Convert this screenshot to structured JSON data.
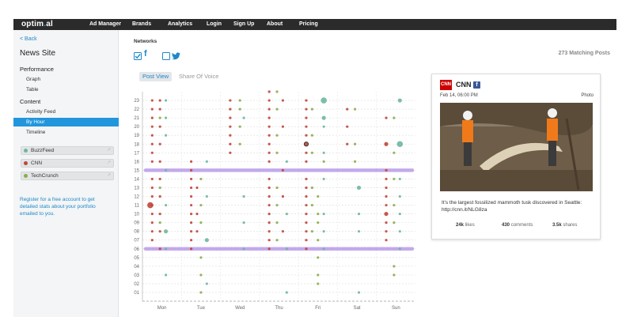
{
  "brand": {
    "logo_main": "optim",
    "logo_dot": ".",
    "logo_tail": "al"
  },
  "nav": {
    "items": [
      {
        "label": "Ad Manager",
        "caret": false
      },
      {
        "label": "Brands",
        "caret": true
      },
      {
        "label": "Analytics",
        "caret": true
      },
      {
        "label": "Login",
        "caret": false
      },
      {
        "label": "Sign Up",
        "caret": false
      },
      {
        "label": "About",
        "caret": true
      },
      {
        "label": "Pricing",
        "caret": false
      }
    ]
  },
  "sidebar": {
    "back_label": "< Back",
    "site_title": "News Site",
    "performance_label": "Performance",
    "performance_items": [
      "Graph",
      "Table"
    ],
    "content_label": "Content",
    "content_items": [
      "Activity Feed",
      "By Hour",
      "Timeline"
    ],
    "active_item": "By Hour",
    "brands": [
      {
        "label": "BuzzFeed",
        "color": "#6fb6a0"
      },
      {
        "label": "CNN",
        "color": "#c0463a"
      },
      {
        "label": "TechCrunch",
        "color": "#8aad4a"
      }
    ],
    "register_text": "Register for a free account to get detailed stats about your portfolio emailed to you."
  },
  "main": {
    "networks_label": "Networks",
    "matching_posts": "273 Matching Posts",
    "networks": [
      {
        "name": "facebook",
        "checked": true
      },
      {
        "name": "twitter",
        "checked": false
      }
    ],
    "tabs": [
      {
        "label": "Post View",
        "active": true
      },
      {
        "label": "Share Of Voice",
        "active": false
      }
    ]
  },
  "chart_data": {
    "type": "scatter",
    "x_categories": [
      "Mon",
      "Tue",
      "Wed",
      "Thu",
      "Fri",
      "Sat",
      "Sun"
    ],
    "y_ticks": [
      "01",
      "02",
      "03",
      "04",
      "05",
      "06",
      "07",
      "08",
      "09",
      "10",
      "11",
      "12",
      "13",
      "14",
      "15",
      "16",
      "17",
      "18",
      "19",
      "20",
      "21",
      "22",
      "23"
    ],
    "ylim": [
      0,
      24
    ],
    "highlight_band_hours": [
      6,
      15
    ],
    "series": [
      {
        "name": "BuzzFeed",
        "color": "#6fb6a0"
      },
      {
        "name": "CNN",
        "color": "#c0463a"
      },
      {
        "name": "TechCrunch",
        "color": "#8aad4a"
      }
    ],
    "points": [
      [
        0,
        -0.25,
        23,
        "c",
        1
      ],
      [
        0,
        -0.25,
        22,
        "c",
        1
      ],
      [
        0,
        -0.25,
        21,
        "c",
        1
      ],
      [
        0,
        -0.25,
        20,
        "c",
        1
      ],
      [
        0,
        -0.25,
        19,
        "c",
        1
      ],
      [
        0,
        -0.25,
        18,
        "c",
        1
      ],
      [
        0,
        -0.25,
        17,
        "c",
        1
      ],
      [
        0,
        -0.25,
        16,
        "c",
        1
      ],
      [
        0,
        -0.25,
        14,
        "c",
        1
      ],
      [
        0,
        -0.25,
        13,
        "c",
        1
      ],
      [
        0,
        -0.25,
        12,
        "c",
        1
      ],
      [
        0,
        -0.25,
        11,
        "c",
        1
      ],
      [
        0,
        -0.25,
        10,
        "c",
        1
      ],
      [
        0,
        -0.25,
        9,
        "c",
        1
      ],
      [
        0,
        -0.25,
        8,
        "c",
        1
      ],
      [
        0,
        -0.25,
        7,
        "c",
        1
      ],
      [
        0,
        -0.3,
        11,
        "c",
        3
      ],
      [
        0,
        -0.05,
        23,
        "c",
        1
      ],
      [
        0,
        -0.05,
        22,
        "c",
        1
      ],
      [
        0,
        -0.05,
        20,
        "c",
        1
      ],
      [
        0,
        -0.05,
        18,
        "c",
        1
      ],
      [
        0,
        -0.05,
        16,
        "c",
        1
      ],
      [
        0,
        -0.05,
        14,
        "c",
        1
      ],
      [
        0,
        -0.05,
        12,
        "c",
        1
      ],
      [
        0,
        -0.05,
        10,
        "c",
        1
      ],
      [
        0,
        -0.05,
        8,
        "c",
        1
      ],
      [
        0,
        -0.05,
        6,
        "c",
        1
      ],
      [
        0,
        -0.05,
        21,
        "t",
        1
      ],
      [
        0,
        -0.05,
        13,
        "t",
        1
      ],
      [
        0,
        -0.05,
        9,
        "t",
        1
      ],
      [
        0,
        0.1,
        23,
        "b",
        1
      ],
      [
        0,
        0.1,
        21,
        "b",
        1
      ],
      [
        0,
        0.1,
        19,
        "b",
        1
      ],
      [
        0,
        0.1,
        15,
        "b",
        1
      ],
      [
        0,
        0.1,
        11,
        "b",
        1
      ],
      [
        0,
        0.1,
        8,
        "b",
        2
      ],
      [
        0,
        0.1,
        6,
        "b",
        1
      ],
      [
        0,
        0.1,
        3,
        "b",
        1
      ],
      [
        1,
        -0.25,
        16,
        "c",
        1
      ],
      [
        1,
        -0.25,
        15,
        "c",
        1
      ],
      [
        1,
        -0.25,
        14,
        "c",
        1
      ],
      [
        1,
        -0.25,
        13,
        "c",
        1
      ],
      [
        1,
        -0.25,
        12,
        "c",
        1
      ],
      [
        1,
        -0.25,
        11,
        "c",
        1
      ],
      [
        1,
        -0.25,
        10,
        "c",
        1
      ],
      [
        1,
        -0.25,
        9,
        "c",
        1
      ],
      [
        1,
        -0.25,
        8,
        "c",
        1
      ],
      [
        1,
        -0.25,
        7,
        "c",
        1
      ],
      [
        1,
        -0.25,
        6,
        "c",
        1
      ],
      [
        1,
        -0.1,
        13,
        "c",
        1
      ],
      [
        1,
        -0.1,
        10,
        "c",
        1
      ],
      [
        1,
        -0.1,
        8,
        "c",
        1
      ],
      [
        1,
        0.0,
        14,
        "t",
        1
      ],
      [
        1,
        0.0,
        11,
        "t",
        1
      ],
      [
        1,
        0.0,
        9,
        "t",
        1
      ],
      [
        1,
        0.0,
        5,
        "t",
        1
      ],
      [
        1,
        0.0,
        3,
        "t",
        1
      ],
      [
        1,
        0.0,
        1,
        "t",
        1
      ],
      [
        1,
        0.15,
        16,
        "b",
        1
      ],
      [
        1,
        0.15,
        12,
        "b",
        1
      ],
      [
        1,
        0.15,
        7,
        "b",
        2
      ],
      [
        1,
        0.15,
        2,
        "b",
        1
      ],
      [
        2,
        -0.25,
        23,
        "c",
        1
      ],
      [
        2,
        -0.25,
        22,
        "c",
        1
      ],
      [
        2,
        -0.25,
        21,
        "c",
        1
      ],
      [
        2,
        -0.25,
        20,
        "c",
        1
      ],
      [
        2,
        -0.25,
        19,
        "c",
        1
      ],
      [
        2,
        -0.25,
        18,
        "c",
        1
      ],
      [
        2,
        -0.25,
        17,
        "c",
        1
      ],
      [
        2,
        0.0,
        23,
        "t",
        1
      ],
      [
        2,
        0.0,
        22,
        "t",
        1
      ],
      [
        2,
        0.0,
        20,
        "t",
        1
      ],
      [
        2,
        0.0,
        18,
        "t",
        1
      ],
      [
        2,
        0.1,
        21,
        "b",
        1
      ],
      [
        2,
        0.1,
        12,
        "b",
        1
      ],
      [
        2,
        0.1,
        9,
        "b",
        1
      ],
      [
        2,
        0.1,
        6,
        "b",
        1
      ],
      [
        3,
        -0.25,
        24,
        "c",
        1
      ],
      [
        3,
        -0.25,
        23,
        "c",
        1
      ],
      [
        3,
        -0.25,
        22,
        "c",
        1
      ],
      [
        3,
        -0.25,
        21,
        "c",
        1
      ],
      [
        3,
        -0.25,
        20,
        "c",
        1
      ],
      [
        3,
        -0.25,
        19,
        "c",
        1
      ],
      [
        3,
        -0.25,
        18,
        "c",
        1
      ],
      [
        3,
        -0.25,
        17,
        "c",
        1
      ],
      [
        3,
        -0.25,
        16,
        "c",
        1
      ],
      [
        3,
        -0.25,
        14,
        "c",
        1
      ],
      [
        3,
        -0.25,
        13,
        "c",
        1
      ],
      [
        3,
        -0.25,
        12,
        "c",
        1
      ],
      [
        3,
        -0.25,
        11,
        "c",
        1
      ],
      [
        3,
        -0.25,
        10,
        "c",
        1
      ],
      [
        3,
        -0.25,
        9,
        "c",
        1
      ],
      [
        3,
        -0.25,
        8,
        "c",
        1
      ],
      [
        3,
        -0.25,
        7,
        "c",
        1
      ],
      [
        3,
        -0.25,
        6,
        "c",
        1
      ],
      [
        3,
        -0.05,
        24,
        "t",
        1
      ],
      [
        3,
        -0.05,
        22,
        "t",
        1
      ],
      [
        3,
        -0.05,
        19,
        "t",
        1
      ],
      [
        3,
        -0.05,
        17,
        "t",
        1
      ],
      [
        3,
        -0.05,
        13,
        "t",
        1
      ],
      [
        3,
        -0.05,
        11,
        "t",
        1
      ],
      [
        3,
        -0.05,
        9,
        "t",
        1
      ],
      [
        3,
        -0.05,
        7,
        "t",
        1
      ],
      [
        3,
        0.1,
        23,
        "c",
        1
      ],
      [
        3,
        0.1,
        20,
        "c",
        1
      ],
      [
        3,
        0.1,
        15,
        "c",
        1
      ],
      [
        3,
        0.1,
        12,
        "c",
        1
      ],
      [
        3,
        0.1,
        8,
        "c",
        1
      ],
      [
        3,
        0.2,
        16,
        "b",
        1
      ],
      [
        3,
        0.2,
        10,
        "b",
        1
      ],
      [
        3,
        0.2,
        6,
        "b",
        1
      ],
      [
        3,
        0.2,
        1,
        "b",
        1
      ],
      [
        4,
        -0.3,
        23,
        "c",
        1
      ],
      [
        4,
        -0.3,
        22,
        "c",
        1
      ],
      [
        4,
        -0.3,
        21,
        "c",
        1
      ],
      [
        4,
        -0.3,
        20,
        "c",
        1
      ],
      [
        4,
        -0.3,
        19,
        "c",
        1
      ],
      [
        4,
        -0.3,
        18,
        "c",
        2
      ],
      [
        4,
        -0.3,
        17,
        "c",
        1
      ],
      [
        4,
        -0.3,
        16,
        "c",
        1
      ],
      [
        4,
        -0.3,
        14,
        "c",
        1
      ],
      [
        4,
        -0.3,
        13,
        "c",
        1
      ],
      [
        4,
        -0.3,
        12,
        "c",
        1
      ],
      [
        4,
        -0.3,
        11,
        "c",
        1
      ],
      [
        4,
        -0.3,
        10,
        "c",
        1
      ],
      [
        4,
        -0.3,
        9,
        "c",
        1
      ],
      [
        4,
        -0.3,
        8,
        "c",
        1
      ],
      [
        4,
        -0.3,
        7,
        "c",
        1
      ],
      [
        4,
        -0.3,
        6,
        "c",
        1
      ],
      [
        4,
        -0.15,
        22,
        "t",
        1
      ],
      [
        4,
        -0.15,
        19,
        "t",
        1
      ],
      [
        4,
        -0.15,
        17,
        "t",
        1
      ],
      [
        4,
        -0.15,
        13,
        "t",
        1
      ],
      [
        4,
        -0.15,
        11,
        "t",
        1
      ],
      [
        4,
        -0.15,
        8,
        "t",
        1
      ],
      [
        4,
        0.0,
        12,
        "t",
        1
      ],
      [
        4,
        0.0,
        10,
        "t",
        1
      ],
      [
        4,
        0.0,
        9,
        "t",
        1
      ],
      [
        4,
        0.0,
        7,
        "t",
        1
      ],
      [
        4,
        0.0,
        5,
        "t",
        1
      ],
      [
        4,
        0.0,
        3,
        "t",
        1
      ],
      [
        4,
        0.0,
        2,
        "t",
        1
      ],
      [
        4,
        0.15,
        23,
        "b",
        3
      ],
      [
        4,
        0.15,
        21,
        "b",
        2
      ],
      [
        4,
        0.15,
        20,
        "b",
        1
      ],
      [
        4,
        0.15,
        17,
        "b",
        1
      ],
      [
        4,
        0.15,
        16,
        "t",
        1
      ],
      [
        4,
        0.15,
        14,
        "b",
        1
      ],
      [
        4,
        0.15,
        10,
        "b",
        1
      ],
      [
        4,
        0.15,
        8,
        "b",
        1
      ],
      [
        4,
        0.15,
        6,
        "b",
        1
      ],
      [
        5,
        -0.25,
        22,
        "c",
        1
      ],
      [
        5,
        -0.25,
        20,
        "c",
        1
      ],
      [
        5,
        -0.25,
        18,
        "c",
        1
      ],
      [
        5,
        -0.05,
        22,
        "t",
        1
      ],
      [
        5,
        -0.05,
        18,
        "t",
        1
      ],
      [
        5,
        -0.05,
        16,
        "t",
        1
      ],
      [
        5,
        0.05,
        13,
        "b",
        2
      ],
      [
        5,
        0.05,
        10,
        "b",
        1
      ],
      [
        5,
        0.05,
        8,
        "b",
        1
      ],
      [
        5,
        0.05,
        1,
        "b",
        1
      ],
      [
        6,
        -0.25,
        21,
        "c",
        1
      ],
      [
        6,
        -0.25,
        18,
        "c",
        2
      ],
      [
        6,
        -0.25,
        15,
        "c",
        1
      ],
      [
        6,
        -0.25,
        14,
        "c",
        1
      ],
      [
        6,
        -0.25,
        13,
        "c",
        1
      ],
      [
        6,
        -0.25,
        12,
        "c",
        1
      ],
      [
        6,
        -0.25,
        11,
        "c",
        1
      ],
      [
        6,
        -0.25,
        10,
        "c",
        2
      ],
      [
        6,
        -0.25,
        9,
        "c",
        1
      ],
      [
        6,
        -0.25,
        8,
        "c",
        1
      ],
      [
        6,
        -0.25,
        7,
        "c",
        1
      ],
      [
        6,
        -0.05,
        21,
        "t",
        1
      ],
      [
        6,
        -0.05,
        17,
        "t",
        1
      ],
      [
        6,
        -0.05,
        14,
        "t",
        1
      ],
      [
        6,
        -0.05,
        11,
        "t",
        1
      ],
      [
        6,
        -0.05,
        9,
        "t",
        1
      ],
      [
        6,
        -0.05,
        4,
        "t",
        1
      ],
      [
        6,
        -0.05,
        3,
        "t",
        1
      ],
      [
        6,
        0.1,
        23,
        "b",
        2
      ],
      [
        6,
        0.1,
        18,
        "b",
        3
      ],
      [
        6,
        0.1,
        14,
        "b",
        1
      ],
      [
        6,
        0.1,
        12,
        "b",
        1
      ],
      [
        6,
        0.1,
        10,
        "b",
        1
      ],
      [
        6,
        0.1,
        8,
        "b",
        1
      ],
      [
        6,
        0.1,
        6,
        "b",
        1
      ]
    ]
  },
  "post": {
    "source": "CNN",
    "logo_text": "CNN",
    "date": "Feb 14, 06:00 PM",
    "type": "Photo",
    "text": "It's the largest fossilized mammoth tusk discovered in Seattle: http://cnn.it/NLG8za",
    "likes_value": "24k",
    "likes_label": "likes",
    "comments_value": "430",
    "comments_label": "comments",
    "shares_value": "3.5k",
    "shares_label": "shares"
  },
  "colors": {
    "accent": "#2196dc",
    "nav_bg": "#2b2b2b",
    "band": "#b596e8"
  },
  "icons": {
    "facebook": "facebook-icon",
    "twitter": "twitter-icon",
    "external": "external-link-icon",
    "checkbox": "checkbox-icon"
  }
}
